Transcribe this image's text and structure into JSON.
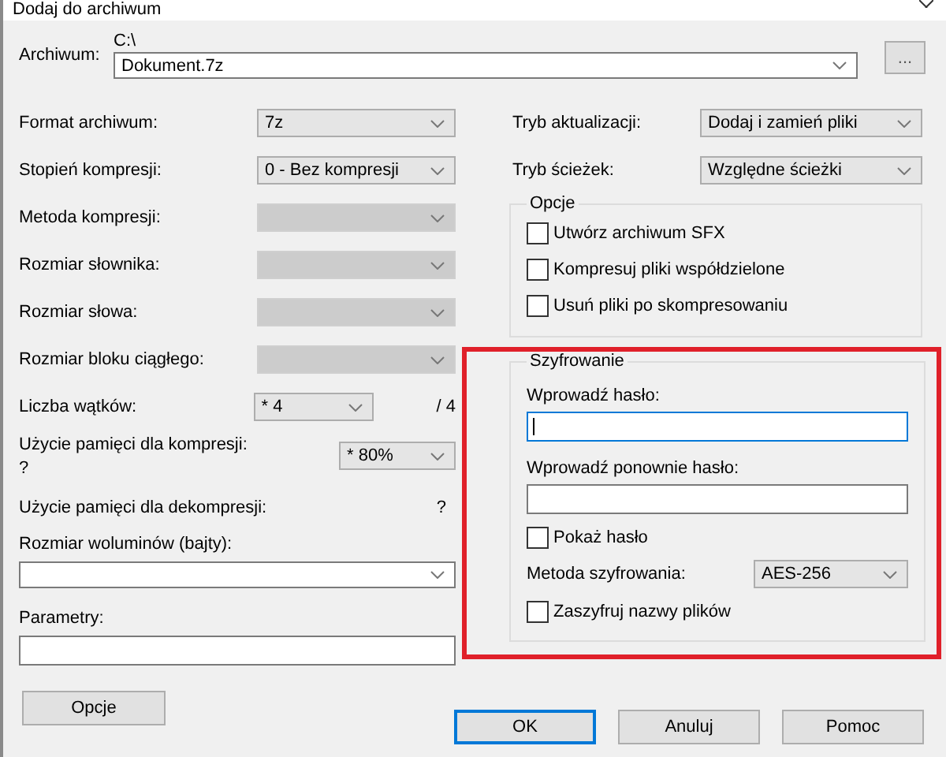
{
  "window": {
    "title": "Dodaj do archiwum"
  },
  "archive": {
    "label": "Archiwum:",
    "path": "C:\\",
    "value": "Dokument.7z",
    "browse": "..."
  },
  "left_fields": [
    {
      "kind": "combo",
      "label": "Format archiwum:",
      "value": "7z",
      "disabled": false
    },
    {
      "kind": "combo",
      "label": "Stopień kompresji:",
      "value": "0 - Bez kompresji",
      "disabled": false
    },
    {
      "kind": "combo",
      "label": "Metoda kompresji:",
      "disabled": true
    },
    {
      "kind": "combo",
      "label": "Rozmiar słownika:",
      "disabled": true
    },
    {
      "kind": "combo",
      "label": "Rozmiar słowa:",
      "disabled": true
    },
    {
      "kind": "combo",
      "label": "Rozmiar bloku ciągłego:",
      "disabled": true
    },
    {
      "kind": "threads",
      "label": "Liczba wątków:",
      "value": "* 4",
      "suffix": "/ 4",
      "disabled": false
    },
    {
      "kind": "memory",
      "label": "Użycie pamięci dla kompresji:",
      "note": "?",
      "value": "* 80%",
      "disabled": false
    },
    {
      "kind": "info",
      "label": "Użycie pamięci dla dekompresji:",
      "value": "?"
    }
  ],
  "volumes": {
    "label": "Rozmiar woluminów (bajty):"
  },
  "parameters": {
    "label": "Parametry:"
  },
  "options_button": "Opcje",
  "right_fields": [
    {
      "label": "Tryb aktualizacji:",
      "value": "Dodaj i zamień pliki"
    },
    {
      "label": "Tryb ścieżek:",
      "value": "Względne ścieżki"
    }
  ],
  "options_group": {
    "title": "Opcje",
    "checkboxes": [
      {
        "label": "Utwórz archiwum SFX",
        "checked": false
      },
      {
        "label": "Kompresuj pliki współdzielone",
        "checked": false
      },
      {
        "label": "Usuń pliki po skompresowaniu",
        "checked": false
      }
    ]
  },
  "encryption": {
    "title": "Szyfrowanie",
    "highlighted": true,
    "password_label": "Wprowadź hasło:",
    "repeat_label": "Wprowadź ponownie hasło:",
    "show_password": {
      "label": "Pokaż hasło",
      "checked": false
    },
    "method_label": "Metoda szyfrowania:",
    "method": "AES-256",
    "encrypt_names": {
      "label": "Zaszyfruj nazwy plików",
      "checked": false
    }
  },
  "buttons": [
    {
      "label": "OK",
      "default": true
    },
    {
      "label": "Anuluj",
      "default": false
    },
    {
      "label": "Pomoc",
      "default": false
    }
  ]
}
